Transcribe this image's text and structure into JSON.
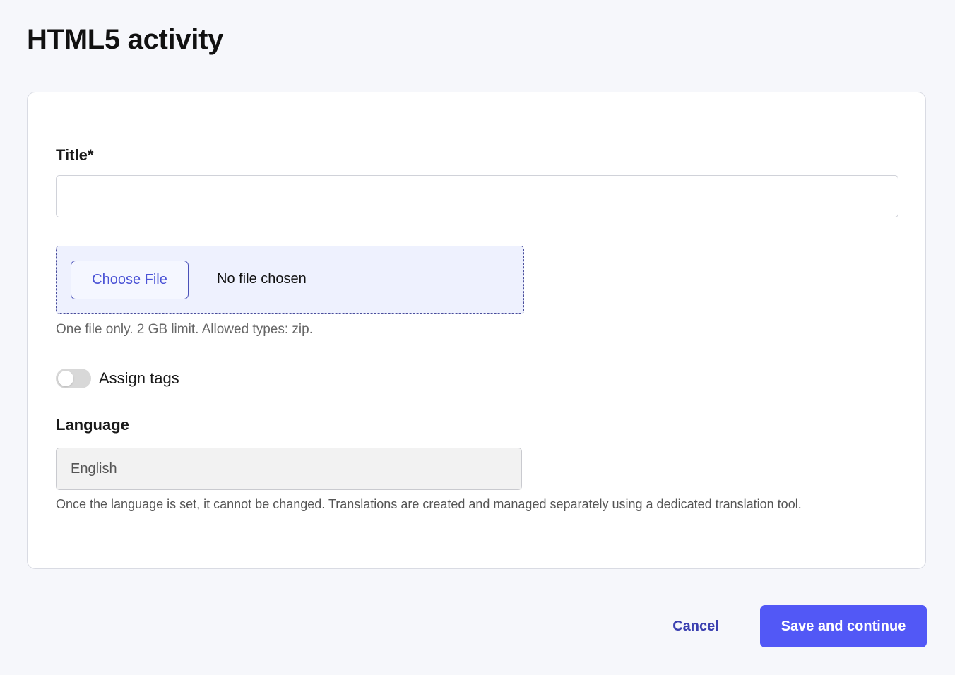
{
  "page": {
    "title": "HTML5 activity"
  },
  "form": {
    "title_field": {
      "label": "Title*",
      "value": "",
      "placeholder": ""
    },
    "file_upload": {
      "button_label": "Choose File",
      "status": "No file chosen",
      "help_text": "One file only. 2 GB limit. Allowed types: zip."
    },
    "assign_tags": {
      "label": "Assign tags",
      "enabled": false
    },
    "language": {
      "label": "Language",
      "value": "English",
      "help_text": "Once the language is set, it cannot be changed. Translations are created and managed separately using a dedicated translation tool."
    }
  },
  "actions": {
    "cancel_label": "Cancel",
    "save_label": "Save and continue"
  },
  "colors": {
    "background": "#f6f7fb",
    "primary": "#5258f6",
    "primary_text": "#4b53d6",
    "dropzone_bg": "#eef1fe",
    "disabled_field_bg": "#f2f2f2"
  }
}
